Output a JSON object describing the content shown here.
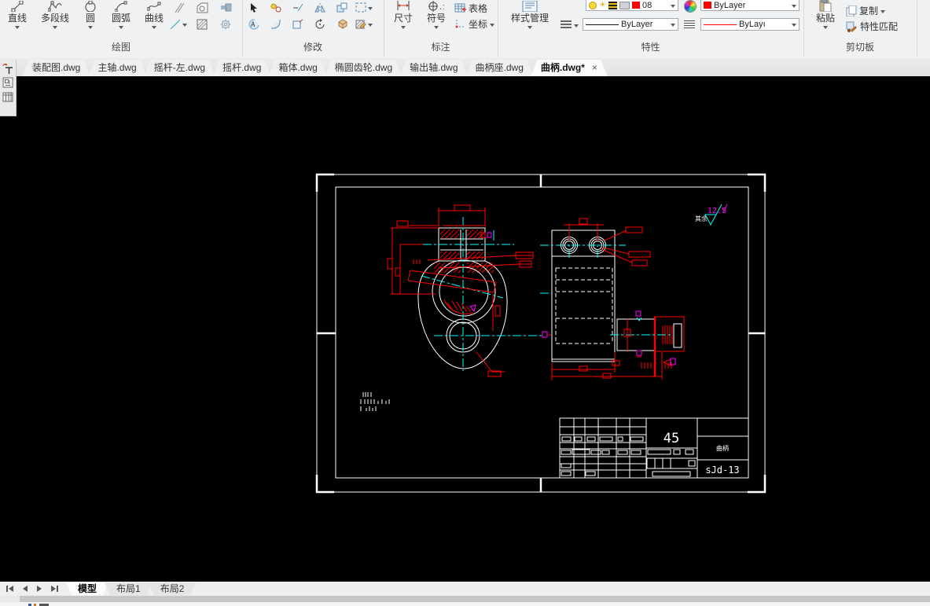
{
  "colors": {
    "line_white": "#ffffff",
    "dimension_red": "#ff0000",
    "centerline_cyan": "#00ffff",
    "symbol_magenta": "#ff00ff",
    "layer_swatch_red": "#ff0000",
    "canvas_black": "#000000"
  },
  "ribbon": {
    "draw": {
      "label": "绘图",
      "line": "直线",
      "polyline": "多段线",
      "circle": "圆",
      "arc": "圆弧",
      "spline": "曲线"
    },
    "modify": {
      "label": "修改"
    },
    "annotate": {
      "label": "标注",
      "dimension": "尺寸",
      "symbol": "符号",
      "table": "表格",
      "coordinate": "坐标"
    },
    "properties": {
      "label": "特性",
      "style_manager": "样式管理",
      "layer_value": "08",
      "color_value": "ByLayer",
      "linetype_value": "ByLayer",
      "lineweight_value": "ByLayı"
    },
    "clipboard": {
      "label": "剪切板",
      "paste": "粘贴",
      "copy": "复制",
      "match": "特性匹配"
    }
  },
  "file_tabs": {
    "tabs": [
      {
        "label": "装配图.dwg"
      },
      {
        "label": "主轴.dwg"
      },
      {
        "label": "摇杆-左.dwg"
      },
      {
        "label": "摇杆.dwg"
      },
      {
        "label": "箱体.dwg"
      },
      {
        "label": "椭圆齿轮.dwg"
      },
      {
        "label": "输出轴.dwg"
      },
      {
        "label": "曲柄座.dwg"
      },
      {
        "label": "曲柄.dwg*"
      }
    ],
    "active_index": 8,
    "close_glyph": "×"
  },
  "drawing": {
    "material": "45",
    "part_name": "曲柄",
    "drawing_number": "sJd-13",
    "roughness_value": "12.5",
    "roughness_prefix": "其余"
  },
  "layout_bar": {
    "model": "模型",
    "layout1": "布局1",
    "layout2": "布局2"
  }
}
